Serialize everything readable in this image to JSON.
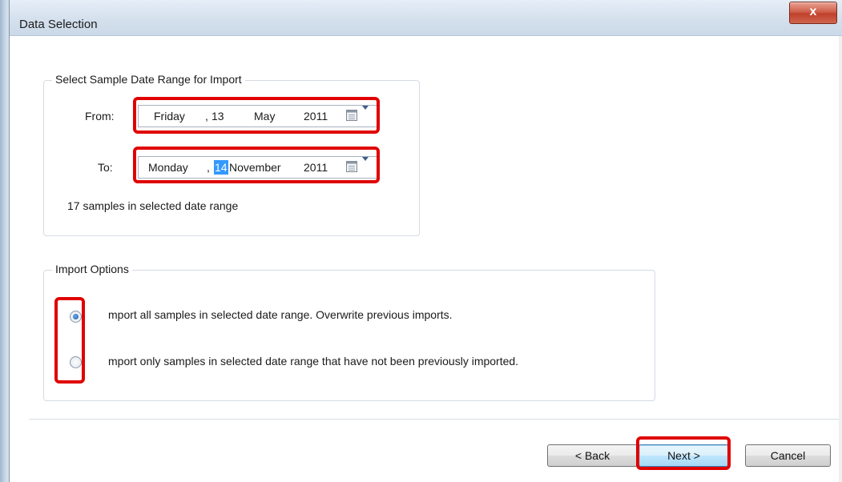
{
  "window": {
    "title": "Data Selection",
    "close_glyph": "x"
  },
  "date_range": {
    "group_label": "Select Sample Date Range for Import",
    "from": {
      "label": "From:",
      "weekday": "Friday",
      "comma": ",",
      "day": "13",
      "month": "May",
      "year": "2011"
    },
    "to": {
      "label": "To:",
      "weekday": "Monday",
      "comma": ",",
      "day": "14",
      "month": "November",
      "year": "2011"
    },
    "status": "17 samples in selected date range"
  },
  "import_options": {
    "group_label": "Import Options",
    "options": [
      {
        "label": "mport all samples in selected date range. Overwrite previous imports.",
        "checked": true
      },
      {
        "label": "mport only samples in selected date range that have not been previously imported.",
        "checked": false
      }
    ]
  },
  "buttons": {
    "back": "< Back",
    "next": "Next >",
    "cancel": "Cancel"
  },
  "colors": {
    "highlight_box": "#e00000",
    "selection": "#3399ff"
  },
  "icons": {
    "calendar": "calendar-icon",
    "dropdown": "chevron-down-icon",
    "close": "close-icon"
  }
}
